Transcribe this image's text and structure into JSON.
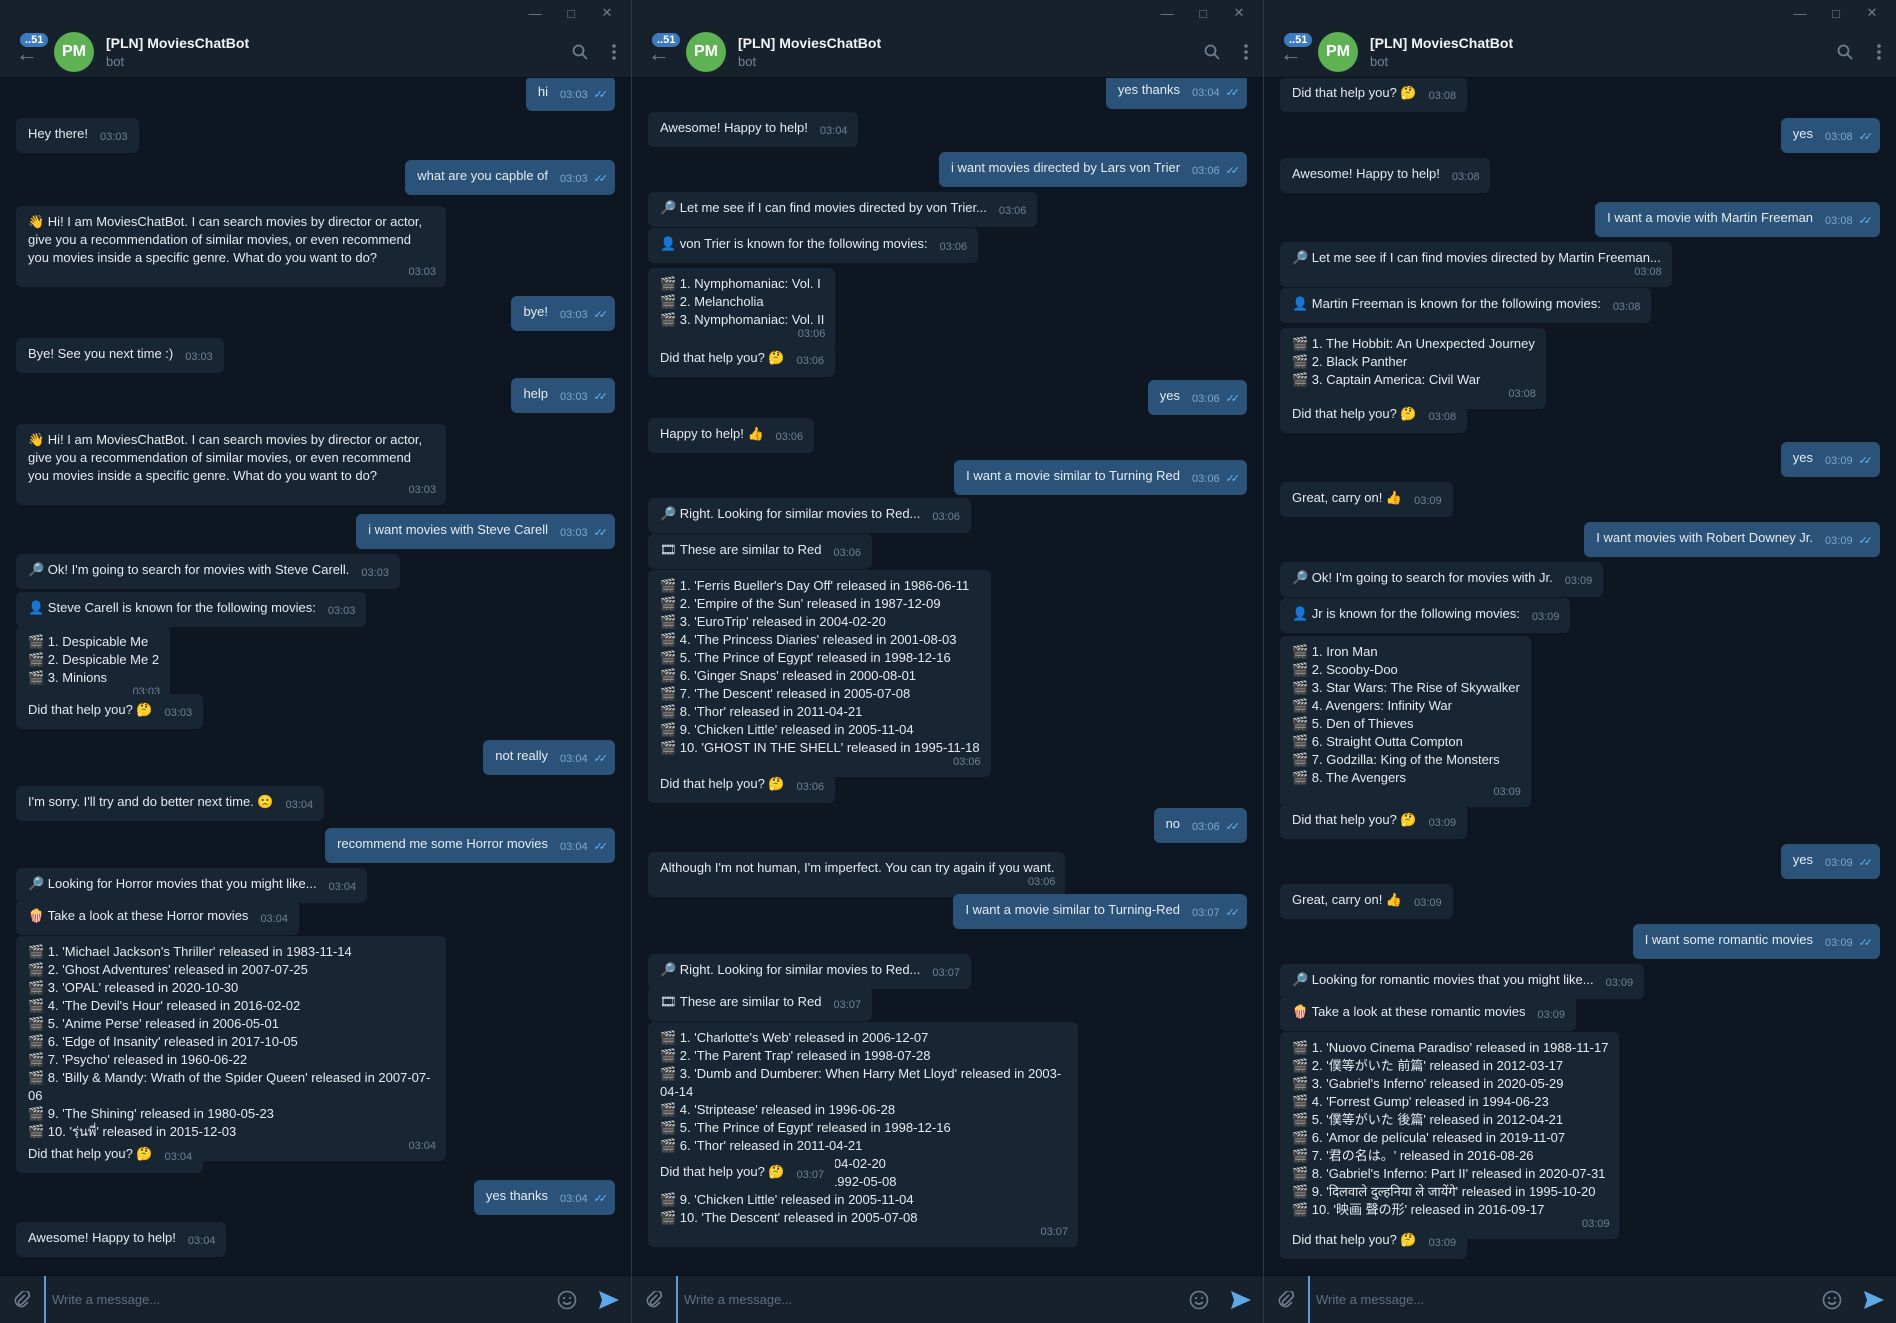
{
  "chat": {
    "title": "[PLN] MoviesChatBot",
    "subtitle": "bot",
    "avatar_initials": "PM",
    "unread_badge": "..51",
    "composer_placeholder": "Write a message...",
    "accent_color": "#2b5278",
    "incoming_color": "#182533",
    "avatar_color": "#5fb254"
  },
  "windows": [
    {
      "messages": [
        {
          "dir": "out",
          "text": "hi",
          "time": "03:03",
          "read": true
        },
        {
          "dir": "in",
          "text": "Hey there!",
          "time": "03:03"
        },
        {
          "dir": "out",
          "text": "what are you capble of",
          "time": "03:03",
          "read": true
        },
        {
          "dir": "in",
          "text": "👋 Hi! I am MoviesChatBot. I can search movies by director or actor, give you a recommendation of similar movies, or even recommend you movies inside a specific genre. What do you want to do?",
          "time": "03:03"
        },
        {
          "dir": "out",
          "text": "bye!",
          "time": "03:03",
          "read": true
        },
        {
          "dir": "in",
          "text": "Bye! See you next time :)",
          "time": "03:03"
        },
        {
          "dir": "out",
          "text": "help",
          "time": "03:03",
          "read": true
        },
        {
          "dir": "in",
          "text": "👋 Hi! I am MoviesChatBot. I can search movies by director or actor, give you a recommendation of similar movies, or even recommend you movies inside a specific genre. What do you want to do?",
          "time": "03:03"
        },
        {
          "dir": "out",
          "text": "i want movies with Steve Carell",
          "time": "03:03",
          "read": true
        },
        {
          "dir": "in",
          "text": "🔎 Ok! I'm going to search for movies with Steve Carell.",
          "time": "03:03"
        },
        {
          "dir": "in",
          "text": "👤 Steve Carell is known for the following movies:",
          "time": "03:03"
        },
        {
          "dir": "in",
          "text": "🎬 1. Despicable Me\n🎬 2. Despicable Me 2\n🎬 3. Minions",
          "time": "03:03"
        },
        {
          "dir": "in",
          "text": "Did that help you? 🤔",
          "time": "03:03"
        },
        {
          "dir": "out",
          "text": "not really",
          "time": "03:04",
          "read": true
        },
        {
          "dir": "in",
          "text": "I'm sorry. I'll try and do better next time. 🙁",
          "time": "03:04"
        },
        {
          "dir": "out",
          "text": "recommend me some Horror movies",
          "time": "03:04",
          "read": true
        },
        {
          "dir": "in",
          "text": "🔎 Looking for Horror movies that you might like...",
          "time": "03:04"
        },
        {
          "dir": "in",
          "text": "🍿 Take a look at these Horror movies",
          "time": "03:04"
        },
        {
          "dir": "in",
          "text": "🎬 1. 'Michael Jackson's Thriller' released in 1983-11-14\n🎬 2. 'Ghost Adventures' released in 2007-07-25\n🎬 3. 'OPAL' released in 2020-10-30\n🎬 4. 'The Devil's Hour' released in 2016-02-02\n🎬 5. 'Anime Perse' released in 2006-05-01\n🎬 6. 'Edge of Insanity' released in 2017-10-05\n🎬 7. 'Psycho' released in 1960-06-22\n🎬 8. 'Billy & Mandy: Wrath of the Spider Queen' released in 2007-07-06\n🎬 9. 'The Shining' released in 1980-05-23\n🎬 10. 'รุ่นพี่' released in 2015-12-03",
          "time": "03:04"
        },
        {
          "dir": "in",
          "text": "Did that help you? 🤔",
          "time": "03:04"
        },
        {
          "dir": "out",
          "text": "yes thanks",
          "time": "03:04",
          "read": true
        },
        {
          "dir": "in",
          "text": "Awesome! Happy to help!",
          "time": "03:04"
        }
      ]
    },
    {
      "messages": [
        {
          "dir": "out",
          "text": "yes thanks",
          "time": "03:04",
          "read": true
        },
        {
          "dir": "in",
          "text": "Awesome! Happy to help!",
          "time": "03:04"
        },
        {
          "dir": "out",
          "text": "i want movies directed by Lars von Trier",
          "time": "03:06",
          "read": true
        },
        {
          "dir": "in",
          "text": "🔎 Let me see if I can find movies directed by von Trier...",
          "time": "03:06"
        },
        {
          "dir": "in",
          "text": "👤 von Trier is known for the following movies:",
          "time": "03:06"
        },
        {
          "dir": "in",
          "text": "🎬 1. Nymphomaniac: Vol. I\n🎬 2. Melancholia\n🎬 3. Nymphomaniac: Vol. II",
          "time": "03:06"
        },
        {
          "dir": "in",
          "text": "Did that help you? 🤔",
          "time": "03:06"
        },
        {
          "dir": "out",
          "text": "yes",
          "time": "03:06",
          "read": true
        },
        {
          "dir": "in",
          "text": "Happy to help! 👍",
          "time": "03:06"
        },
        {
          "dir": "out",
          "text": "I want a movie similar to Turning Red",
          "time": "03:06",
          "read": true
        },
        {
          "dir": "in",
          "text": "🔎 Right. Looking for similar movies to Red...",
          "time": "03:06"
        },
        {
          "dir": "in",
          "text": "🎞 These are similar to Red",
          "time": "03:06"
        },
        {
          "dir": "in",
          "text": "🎬 1. 'Ferris Bueller's Day Off' released in 1986-06-11\n🎬 2. 'Empire of the Sun' released in 1987-12-09\n🎬 3. 'EuroTrip' released in 2004-02-20\n🎬 4. 'The Princess Diaries' released in 2001-08-03\n🎬 5. 'The Prince of Egypt' released in 1998-12-16\n🎬 6. 'Ginger Snaps' released in 2000-08-01\n🎬 7. 'The Descent' released in 2005-07-08\n🎬 8. 'Thor' released in 2011-04-21\n🎬 9. 'Chicken Little' released in 2005-11-04\n🎬 10. 'GHOST IN THE SHELL' released in 1995-11-18",
          "time": "03:06"
        },
        {
          "dir": "in",
          "text": "Did that help you? 🤔",
          "time": "03:06"
        },
        {
          "dir": "out",
          "text": "no",
          "time": "03:06",
          "read": true
        },
        {
          "dir": "in",
          "text": "Although I'm not human, I'm imperfect. You can try again if you want.",
          "time": "03:06"
        },
        {
          "dir": "out",
          "text": "I want a movie similar to Turning-Red",
          "time": "03:07",
          "read": true
        },
        {
          "dir": "in",
          "text": "🔎 Right. Looking for similar movies to Red...",
          "time": "03:07"
        },
        {
          "dir": "in",
          "text": "🎞 These are similar to Red",
          "time": "03:07"
        },
        {
          "dir": "in",
          "text": "🎬 1. 'Charlotte's Web' released in 2006-12-07\n🎬 2. 'The Parent Trap' released in 1998-07-28\n🎬 3. 'Dumb and Dumberer: When Harry Met Lloyd' released in 2003-04-14\n🎬 4. 'Striptease' released in 1996-06-28\n🎬 5. 'The Prince of Egypt' released in 1998-12-16\n🎬 6. 'Thor' released in 2011-04-21\n🎬 7. 'EuroTrip' released in 2004-02-20\n🎬 8. 'Poison Ivy' released in 1992-05-08\n🎬 9. 'Chicken Little' released in 2005-11-04\n🎬 10. 'The Descent' released in 2005-07-08",
          "time": "03:07"
        },
        {
          "dir": "in",
          "text": "Did that help you? 🤔",
          "time": "03:07"
        }
      ]
    },
    {
      "messages": [
        {
          "dir": "in",
          "text": "Did that help you? 🤔",
          "time": "03:08"
        },
        {
          "dir": "out",
          "text": "yes",
          "time": "03:08",
          "read": true
        },
        {
          "dir": "in",
          "text": "Awesome! Happy to help!",
          "time": "03:08"
        },
        {
          "dir": "out",
          "text": "I want a movie with Martin Freeman",
          "time": "03:08",
          "read": true
        },
        {
          "dir": "in",
          "text": "🔎 Let me see if I can find movies directed by Martin Freeman...",
          "time": "03:08"
        },
        {
          "dir": "in",
          "text": "👤 Martin Freeman is known for the following movies:",
          "time": "03:08"
        },
        {
          "dir": "in",
          "text": "🎬 1. The Hobbit: An Unexpected Journey\n🎬 2. Black Panther\n🎬 3. Captain America: Civil War",
          "time": "03:08"
        },
        {
          "dir": "in",
          "text": "Did that help you? 🤔",
          "time": "03:08"
        },
        {
          "dir": "out",
          "text": "yes",
          "time": "03:09",
          "read": true
        },
        {
          "dir": "in",
          "text": "Great, carry on! 👍",
          "time": "03:09"
        },
        {
          "dir": "out",
          "text": "I want movies with Robert Downey Jr.",
          "time": "03:09",
          "read": true
        },
        {
          "dir": "in",
          "text": "🔎 Ok! I'm going to search for movies with Jr.",
          "time": "03:09"
        },
        {
          "dir": "in",
          "text": "👤 Jr is known for the following movies:",
          "time": "03:09"
        },
        {
          "dir": "in",
          "text": "🎬 1. Iron Man\n🎬 2. Scooby-Doo\n🎬 3. Star Wars: The Rise of Skywalker\n🎬 4. Avengers: Infinity War\n🎬 5. Den of Thieves\n🎬 6. Straight Outta Compton\n🎬 7. Godzilla: King of the Monsters\n🎬 8. The Avengers",
          "time": "03:09"
        },
        {
          "dir": "in",
          "text": "Did that help you? 🤔",
          "time": "03:09"
        },
        {
          "dir": "out",
          "text": "yes",
          "time": "03:09",
          "read": true
        },
        {
          "dir": "in",
          "text": "Great, carry on! 👍",
          "time": "03:09"
        },
        {
          "dir": "out",
          "text": "I want some romantic movies",
          "time": "03:09",
          "read": true
        },
        {
          "dir": "in",
          "text": "🔎 Looking for romantic movies that you might like...",
          "time": "03:09"
        },
        {
          "dir": "in",
          "text": "🍿 Take a look at these romantic movies",
          "time": "03:09"
        },
        {
          "dir": "in",
          "text": "🎬 1. 'Nuovo Cinema Paradiso' released in 1988-11-17\n🎬 2. '僕等がいた 前篇' released in 2012-03-17\n🎬 3. 'Gabriel's Inferno' released in 2020-05-29\n🎬 4. 'Forrest Gump' released in 1994-06-23\n🎬 5. '僕等がいた 後篇' released in 2012-04-21\n🎬 6. 'Amor de película' released in 2019-11-07\n🎬 7. '君の名は。' released in 2016-08-26\n🎬 8. 'Gabriel's Inferno: Part II' released in 2020-07-31\n🎬 9. 'दिलवाले दुल्हनिया ले जायेंगे' released in 1995-10-20\n🎬 10. '映画 聲の形' released in 2016-09-17",
          "time": "03:09"
        },
        {
          "dir": "in",
          "text": "Did that help you? 🤔",
          "time": "03:09"
        }
      ]
    }
  ]
}
